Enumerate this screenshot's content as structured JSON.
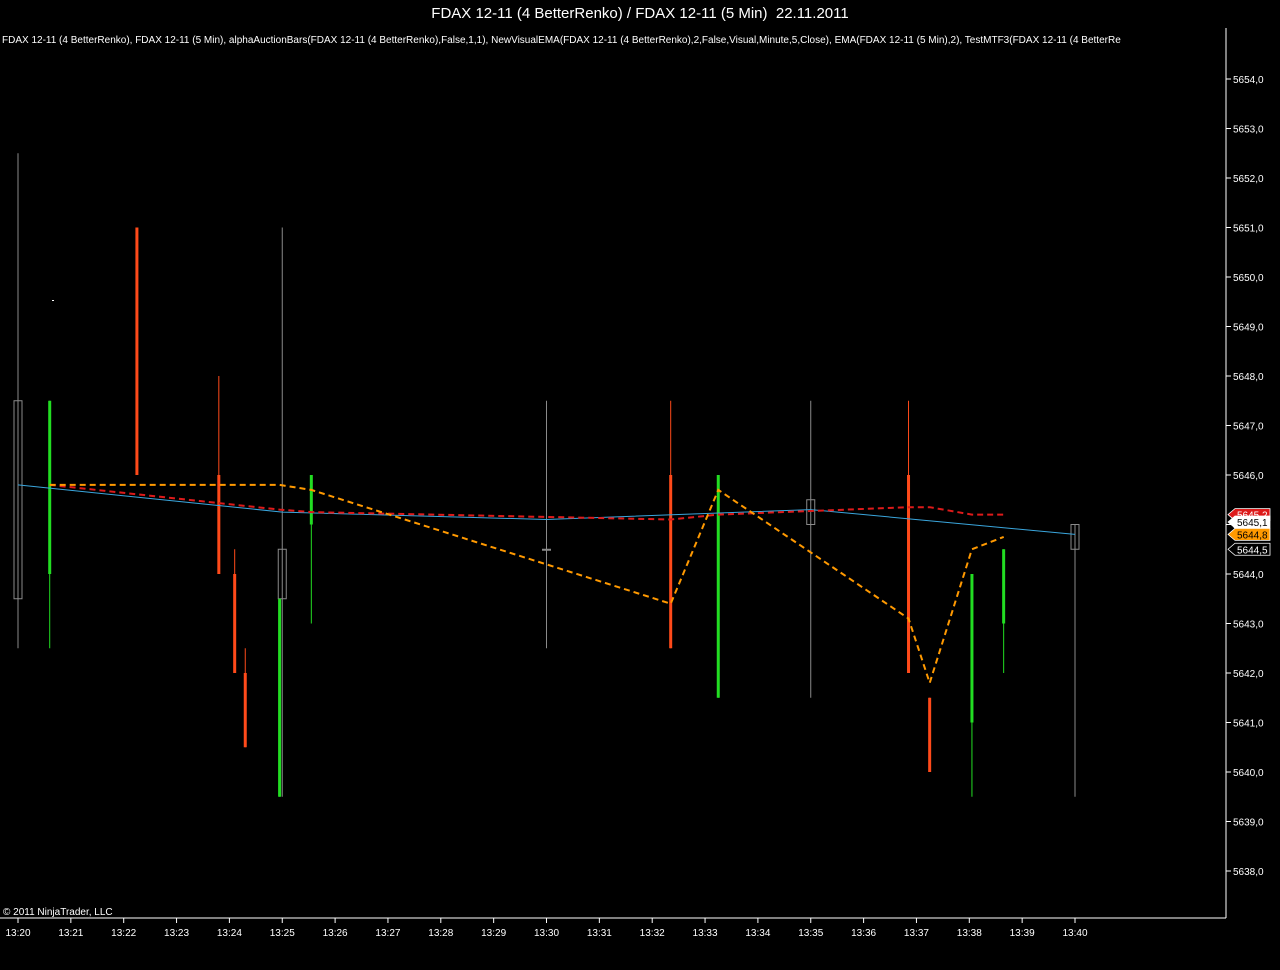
{
  "window_title": "FDAX 12-11 (4 BetterRenko) / FDAX 12-11 (5 Min)  22.11.2011",
  "indicator_header": "FDAX 12-11 (4 BetterRenko), FDAX 12-11 (5 Min), alphaAuctionBars(FDAX 12-11 (4 BetterRenko),False,1,1), NewVisualEMA(FDAX 12-11 (4 BetterRenko),2,False,Visual,Minute,5,Close), EMA(FDAX 12-11 (5 Min),2), TestMTF3(FDAX 12-11 (4 BetterRe",
  "copyright": "© 2011 NinjaTrader, LLC",
  "colors": {
    "background": "#000000",
    "up": "#22dd22",
    "down": "#ff4a1a",
    "neutral": "#8a8a8a",
    "ema_blue": "#3aa6dd",
    "red_dash": "#dd1a1a",
    "orange_dash": "#ff9900",
    "axis": "#ffffff"
  },
  "chart_data": {
    "type": "candlestick",
    "xlabels": [
      "13:20",
      "13:21",
      "13:22",
      "13:23",
      "13:24",
      "13:25",
      "13:26",
      "13:27",
      "13:28",
      "13:29",
      "13:30",
      "13:31",
      "13:32",
      "13:33",
      "13:34",
      "13:35",
      "13:36",
      "13:37",
      "13:38",
      "13:39",
      "13:40"
    ],
    "yticks": [
      "5638,0",
      "5639,0",
      "5640,0",
      "5641,0",
      "5642,0",
      "5643,0",
      "5644,0",
      "5645,0",
      "5646,0",
      "5647,0",
      "5648,0",
      "5649,0",
      "5650,0",
      "5651,0",
      "5652,0",
      "5653,0",
      "5654,0"
    ],
    "ylim": [
      5637.1,
      5655.0
    ],
    "five_min_bars": [
      {
        "t": 0.0,
        "open": 5643.5,
        "high": 5652.5,
        "low": 5642.5,
        "close": 5647.5
      },
      {
        "t": 5.0,
        "open": 5643.5,
        "high": 5651.0,
        "low": 5639.5,
        "close": 5644.5
      },
      {
        "t": 10.0,
        "open": 5644.5,
        "high": 5647.5,
        "low": 5642.5,
        "close": 5644.5
      },
      {
        "t": 15.0,
        "open": 5645.0,
        "high": 5647.5,
        "low": 5641.5,
        "close": 5645.5
      },
      {
        "t": 20.0,
        "open": 5644.5,
        "high": 5645.0,
        "low": 5639.5,
        "close": 5645.0
      }
    ],
    "renko_bars": [
      {
        "t": 0.6,
        "open": 5644.0,
        "high": 5647.5,
        "low": 5642.5,
        "close": 5647.5,
        "dir": "up"
      },
      {
        "t": 2.25,
        "open": 5651.0,
        "high": 5651.0,
        "low": 5646.0,
        "close": 5646.0,
        "dir": "down"
      },
      {
        "t": 3.8,
        "open": 5646.0,
        "high": 5648.0,
        "low": 5644.0,
        "close": 5644.0,
        "dir": "down"
      },
      {
        "t": 4.1,
        "open": 5644.0,
        "high": 5644.5,
        "low": 5642.0,
        "close": 5642.0,
        "dir": "down"
      },
      {
        "t": 4.3,
        "open": 5642.0,
        "high": 5642.5,
        "low": 5640.5,
        "close": 5640.5,
        "dir": "down"
      },
      {
        "t": 4.95,
        "open": 5639.5,
        "high": 5643.5,
        "low": 5639.5,
        "close": 5643.5,
        "dir": "up"
      },
      {
        "t": 5.55,
        "open": 5645.0,
        "high": 5646.0,
        "low": 5643.0,
        "close": 5646.0,
        "dir": "up"
      },
      {
        "t": 12.35,
        "open": 5646.0,
        "high": 5647.5,
        "low": 5642.5,
        "close": 5642.5,
        "dir": "down"
      },
      {
        "t": 13.25,
        "open": 5641.5,
        "high": 5646.0,
        "low": 5641.5,
        "close": 5646.0,
        "dir": "up"
      },
      {
        "t": 16.85,
        "open": 5646.0,
        "high": 5647.5,
        "low": 5642.0,
        "close": 5642.0,
        "dir": "down"
      },
      {
        "t": 17.25,
        "open": 5641.5,
        "high": 5641.5,
        "low": 5640.0,
        "close": 5640.0,
        "dir": "down"
      },
      {
        "t": 18.05,
        "open": 5641.0,
        "high": 5644.0,
        "low": 5639.5,
        "close": 5644.0,
        "dir": "up"
      },
      {
        "t": 18.65,
        "open": 5643.0,
        "high": 5644.5,
        "low": 5642.0,
        "close": 5644.5,
        "dir": "up"
      }
    ],
    "series": [
      {
        "name": "EMA(FDAX 12-11 (5 Min),2)",
        "style": "solid",
        "color": "#3aa6dd",
        "points": [
          [
            0.0,
            5645.8
          ],
          [
            5.0,
            5645.25
          ],
          [
            10.0,
            5645.1
          ],
          [
            15.0,
            5645.3
          ],
          [
            20.0,
            5644.8
          ]
        ]
      },
      {
        "style": "dashed",
        "color": "#dd1a1a",
        "points": [
          [
            0.6,
            5645.8
          ],
          [
            4.95,
            5645.3
          ],
          [
            5.55,
            5645.25
          ],
          [
            12.35,
            5645.1
          ],
          [
            13.25,
            5645.2
          ],
          [
            16.85,
            5645.35
          ],
          [
            17.25,
            5645.35
          ],
          [
            18.05,
            5645.2
          ],
          [
            18.65,
            5645.2
          ]
        ]
      },
      {
        "style": "dashed",
        "color": "#ff9900",
        "points": [
          [
            0.6,
            5645.8
          ],
          [
            4.95,
            5645.8
          ],
          [
            5.55,
            5645.7
          ],
          [
            12.35,
            5643.4
          ],
          [
            13.25,
            5645.7
          ],
          [
            16.85,
            5643.1
          ],
          [
            17.25,
            5641.8
          ],
          [
            18.05,
            5644.5
          ],
          [
            18.65,
            5644.75
          ]
        ]
      }
    ],
    "price_markers": [
      {
        "label": "5645,2",
        "value": 5645.2,
        "color": "#dd1a1a",
        "text_color": "#ffffff"
      },
      {
        "label": "5645,1",
        "value": 5645.05,
        "color": "#ffffff",
        "text_color": "#000000"
      },
      {
        "label": "5644,8",
        "value": 5644.8,
        "color": "#ff9900",
        "text_color": "#000000"
      },
      {
        "label": "5644,5",
        "value": 5644.5,
        "color": "#000000",
        "text_color": "#ffffff"
      }
    ]
  }
}
